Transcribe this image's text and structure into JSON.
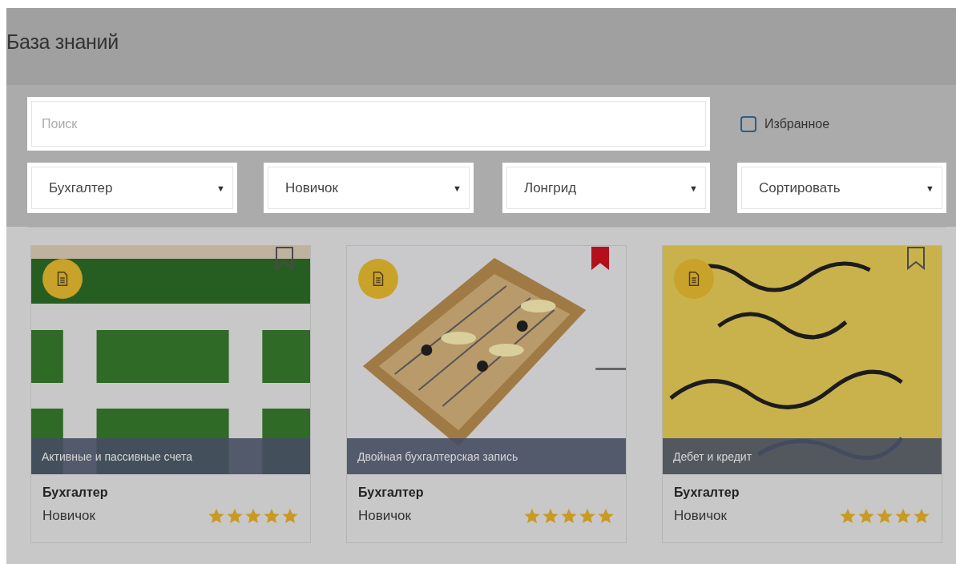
{
  "header": {
    "title": "База знаний"
  },
  "search": {
    "placeholder": "Поиск"
  },
  "favorites": {
    "label": "Избранное",
    "checked": false
  },
  "filters": [
    {
      "value": "Бухгалтер",
      "caret": "▼"
    },
    {
      "value": "Новичок",
      "caret": "▼"
    },
    {
      "value": "Лонгрид",
      "caret": "▼"
    },
    {
      "value": "Сортировать",
      "caret": "▼"
    }
  ],
  "cards": [
    {
      "caption": "Активные и пассивные счета",
      "role": "Бухгалтер",
      "level_name": "Новичок",
      "stars": 5,
      "bookmarked": false
    },
    {
      "caption": "Двойная бухгалтерская запись",
      "role": "Бухгалтер",
      "level_name": "Новичок",
      "stars": 5,
      "bookmarked": true
    },
    {
      "caption": "Дебет и кредит",
      "role": "Бухгалтер",
      "level_name": "Новичок",
      "stars": 5,
      "bookmarked": false
    }
  ]
}
